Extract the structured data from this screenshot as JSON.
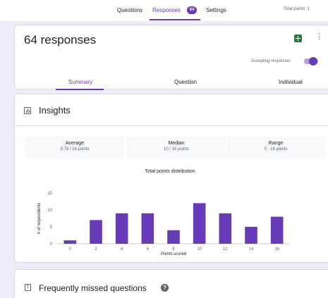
{
  "nav": {
    "tabs": [
      "Questions",
      "Responses",
      "Settings"
    ],
    "responses_badge": "64",
    "total_points": "Total points: 1"
  },
  "header": {
    "title": "64 responses",
    "accepting_label": "Accepting responses",
    "accepting_on": true,
    "subtabs": [
      "Summary",
      "Question",
      "Individual"
    ]
  },
  "insights": {
    "title": "Insights",
    "stats": [
      {
        "label": "Average",
        "value": "8.78 / 16 points"
      },
      {
        "label": "Median",
        "value": "10 / 16 points"
      },
      {
        "label": "Range",
        "value": "0 - 16 points"
      }
    ]
  },
  "chart_data": {
    "type": "bar",
    "title": "Total points distribution",
    "xlabel": "Points scored",
    "ylabel": "# of respondents",
    "categories": [
      "0",
      "2",
      "4",
      "6",
      "8",
      "10",
      "12",
      "14",
      "16"
    ],
    "values": [
      1,
      7,
      9,
      9,
      4,
      12,
      9,
      5,
      8
    ],
    "yticks": [
      0,
      5,
      10,
      15
    ],
    "ylim": [
      0,
      15
    ],
    "bar_color": "#673ab7",
    "grid": false,
    "legend": "none"
  },
  "missed": {
    "title": "Frequently missed questions",
    "icon_glyph": "!",
    "help_glyph": "?"
  },
  "colors": {
    "accent": "#673ab7",
    "background": "#f0ebf8",
    "sheets_green": "#188038"
  }
}
